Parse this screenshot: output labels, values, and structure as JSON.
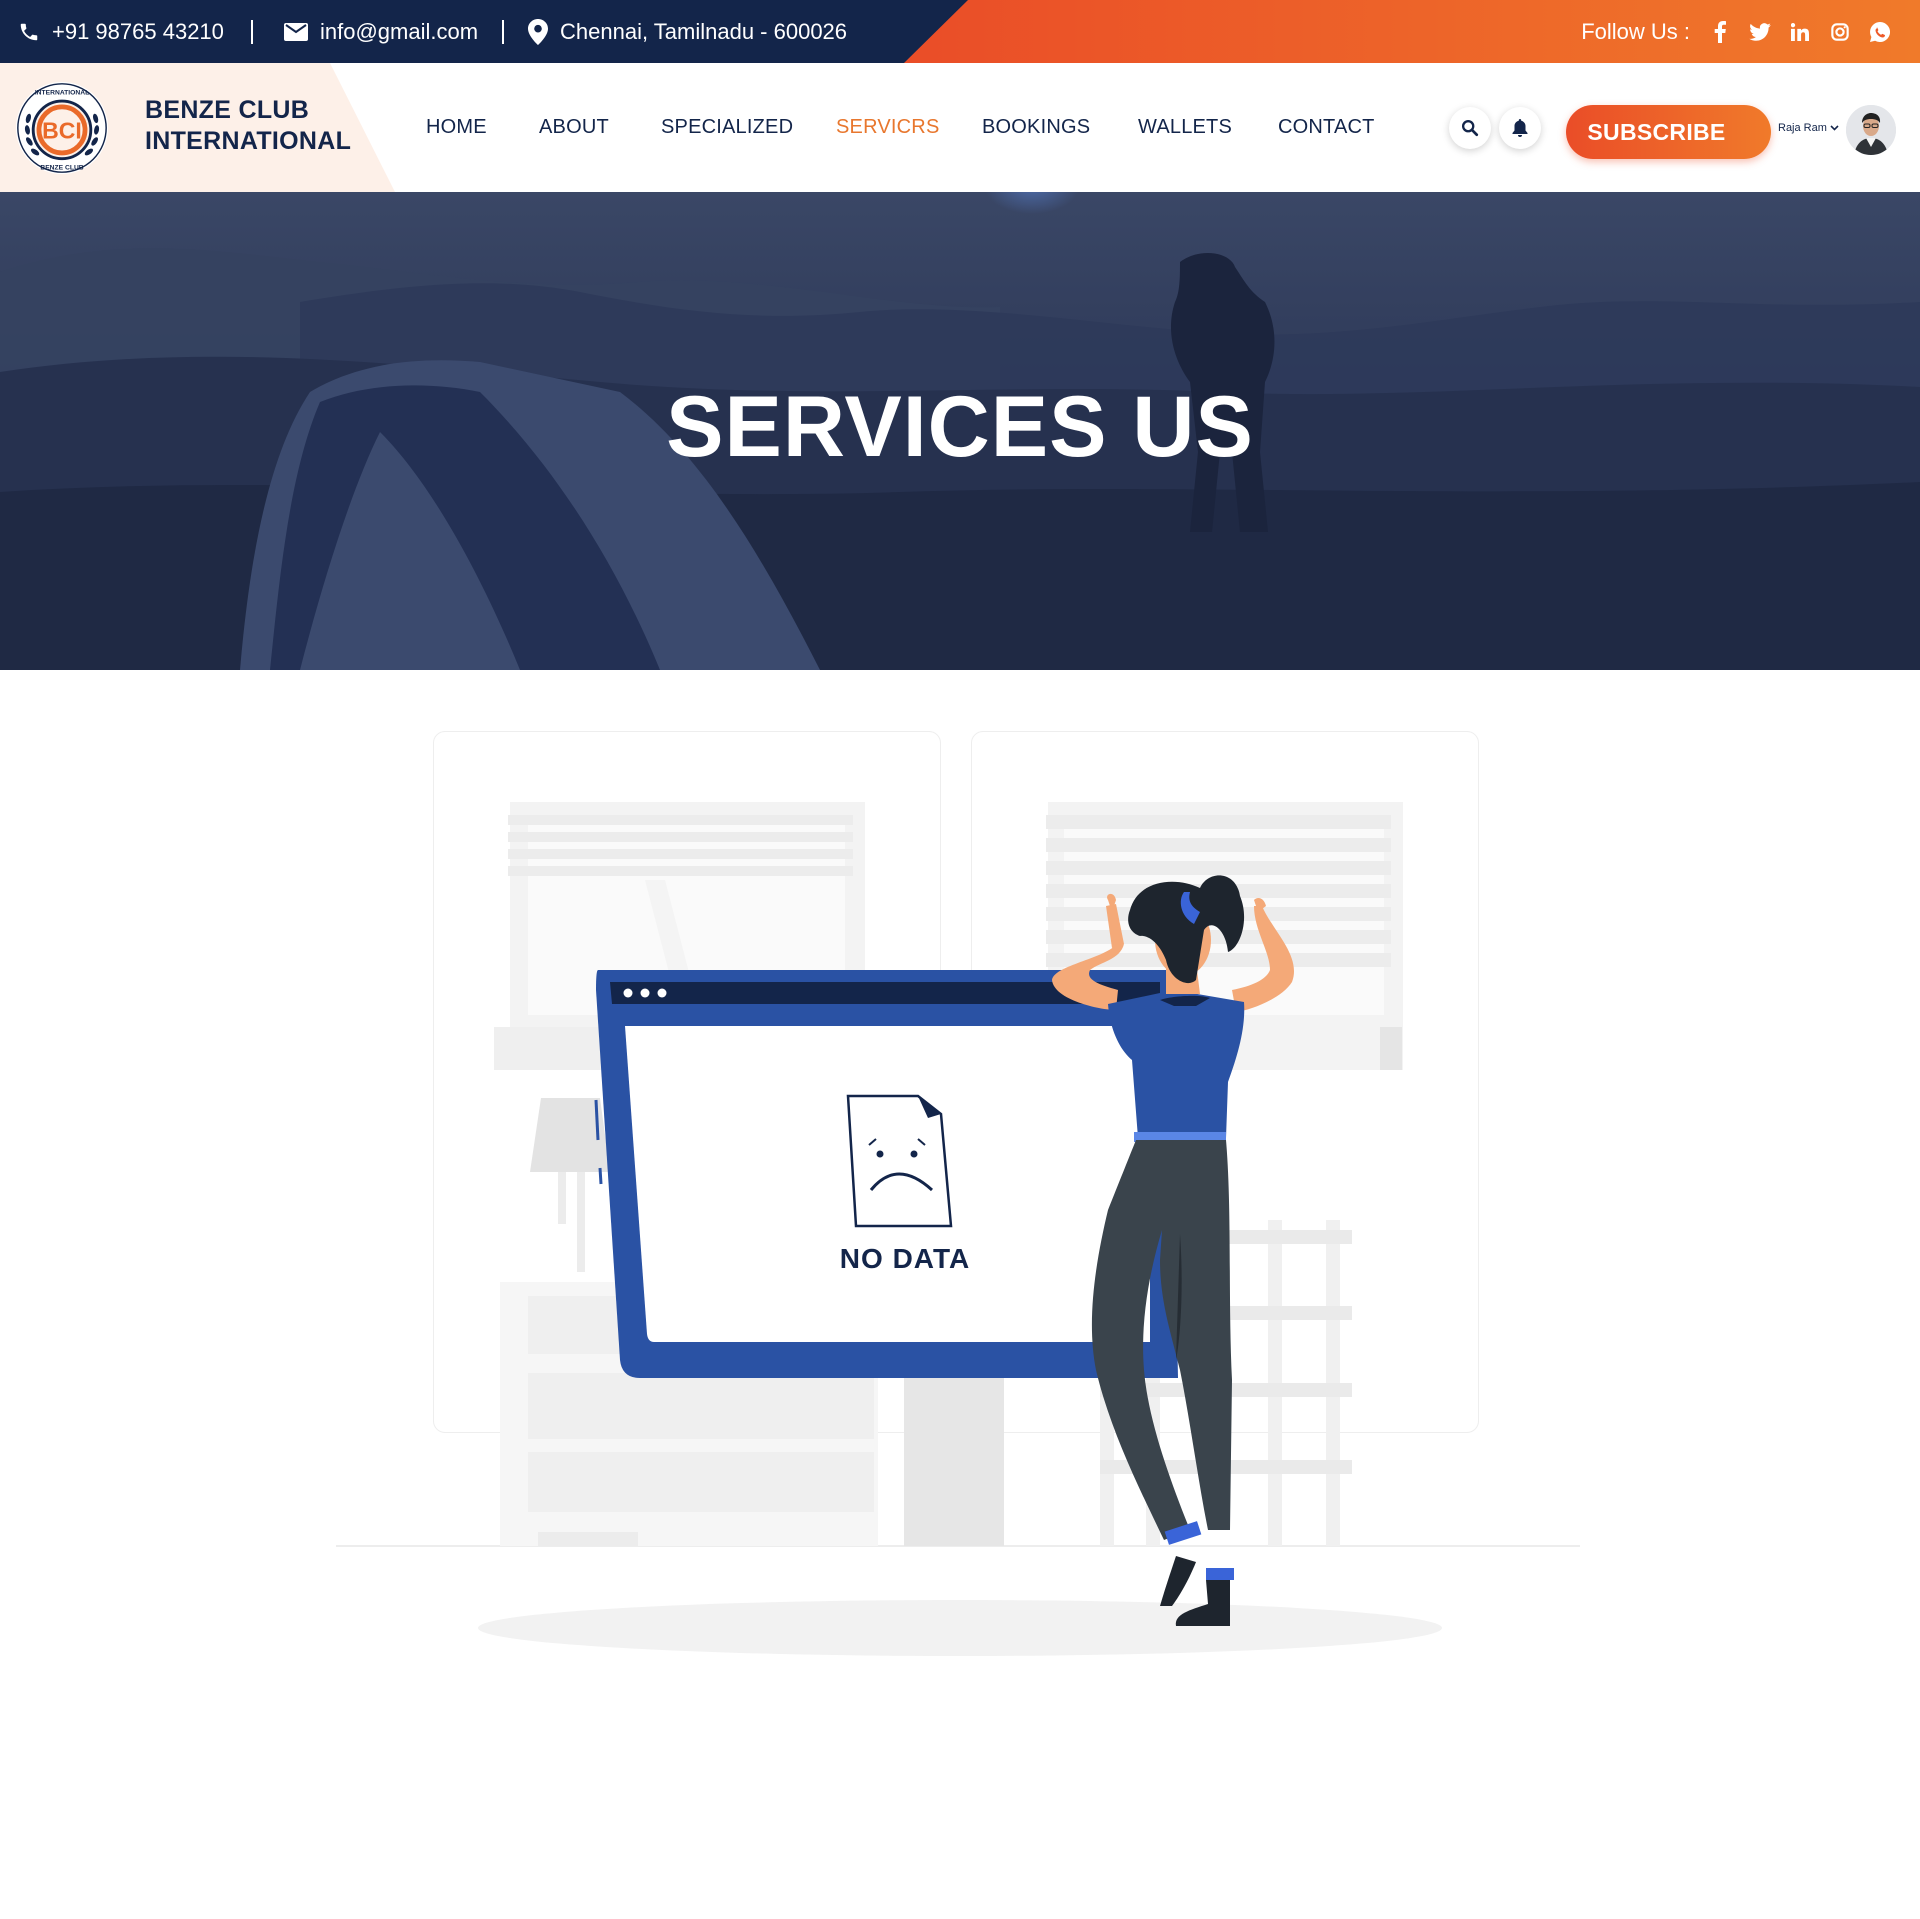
{
  "topbar": {
    "phone": "+91 98765 43210",
    "email": "info@gmail.com",
    "location": "Chennai, Tamilnadu - 600026",
    "follow_label": "Follow Us :",
    "socials": [
      "facebook-icon",
      "twitter-icon",
      "linkedin-icon",
      "instagram-icon",
      "whatsapp-icon"
    ]
  },
  "brand": {
    "line1": "BENZE CLUB",
    "line2": "INTERNATIONAL",
    "logo_text_top": "INTERNATIONAL",
    "logo_text_bottom": "BENZE CLUB",
    "logo_mark": "BCI"
  },
  "nav": {
    "items": [
      "HOME",
      "ABOUT",
      "SPECIALIZED",
      "SERVICRS",
      "BOOKINGS",
      "WALLETS",
      "CONTACT"
    ],
    "active": "SERVICRS",
    "subscribe": "SUBSCRIBE",
    "user_name": "Raja Ram"
  },
  "hero": {
    "title": "SERVICES US"
  },
  "empty_state": {
    "label": "NO DATA"
  },
  "colors": {
    "navy": "#13254a",
    "orange": "#ea4d28",
    "orange_light": "#f07a2a",
    "active_nav": "#e8772e",
    "illustration_blue": "#2a52a4"
  }
}
